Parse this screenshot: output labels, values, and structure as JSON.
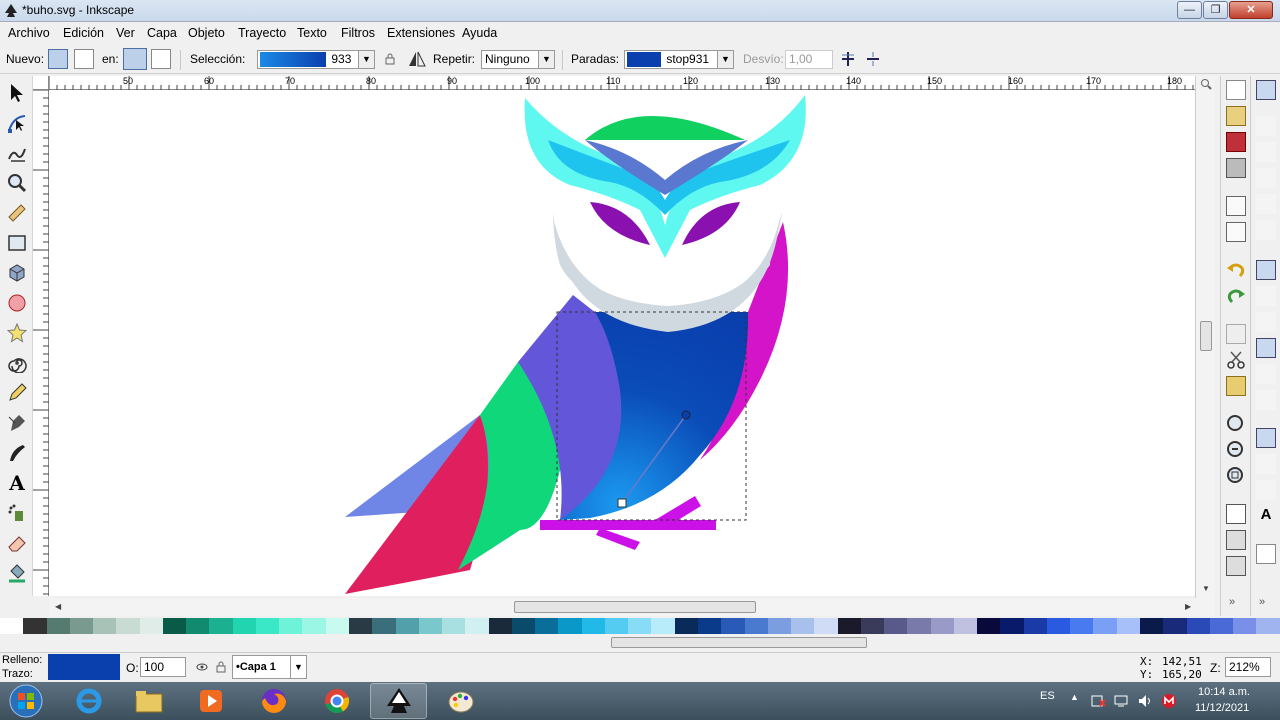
{
  "window": {
    "title": "*buho.svg - Inkscape",
    "min_label": "—",
    "max_label": "❐",
    "close_label": "✕"
  },
  "menu": [
    "Archivo",
    "Edición",
    "Ver",
    "Capa",
    "Objeto",
    "Trayecto",
    "Texto",
    "Filtros",
    "Extensiones",
    "Ayuda"
  ],
  "gradient_toolbar": {
    "nuevo_label": "Nuevo:",
    "en_label": "en:",
    "seleccion_label": "Selección:",
    "seleccion_value": "933",
    "repetir_label": "Repetir:",
    "repetir_value": "Ninguno",
    "paradas_label": "Paradas:",
    "paradas_value": "stop931",
    "desvio_label": "Desvío:",
    "desvio_value": "1,00"
  },
  "ruler_labels": [
    "50",
    "60",
    "70",
    "80",
    "90",
    "100",
    "110",
    "120",
    "130",
    "140",
    "150",
    "160",
    "170",
    "180"
  ],
  "status": {
    "relleno_label": "Relleno:",
    "trazo_label": "Trazo:",
    "fill_color": "#0a3fae",
    "opacity_label": "O:",
    "opacity_value": "100",
    "layer_value": "•Capa 1",
    "x_label": "X:",
    "x_value": "142,51",
    "y_label": "Y:",
    "y_value": "165,20",
    "zoom_label": "Z:",
    "zoom_value": "212%"
  },
  "taskbar": {
    "lang": "ES",
    "time": "10:14 a.m.",
    "date": "11/12/2021"
  },
  "colors": {
    "owl_magenta": "#d414c8",
    "owl_green": "#10d068",
    "owl_cyan": "#5ef8f0",
    "owl_blue": "#0a3fae",
    "owl_purple": "#8a10b0",
    "owl_slate": "#d0d8e0"
  }
}
